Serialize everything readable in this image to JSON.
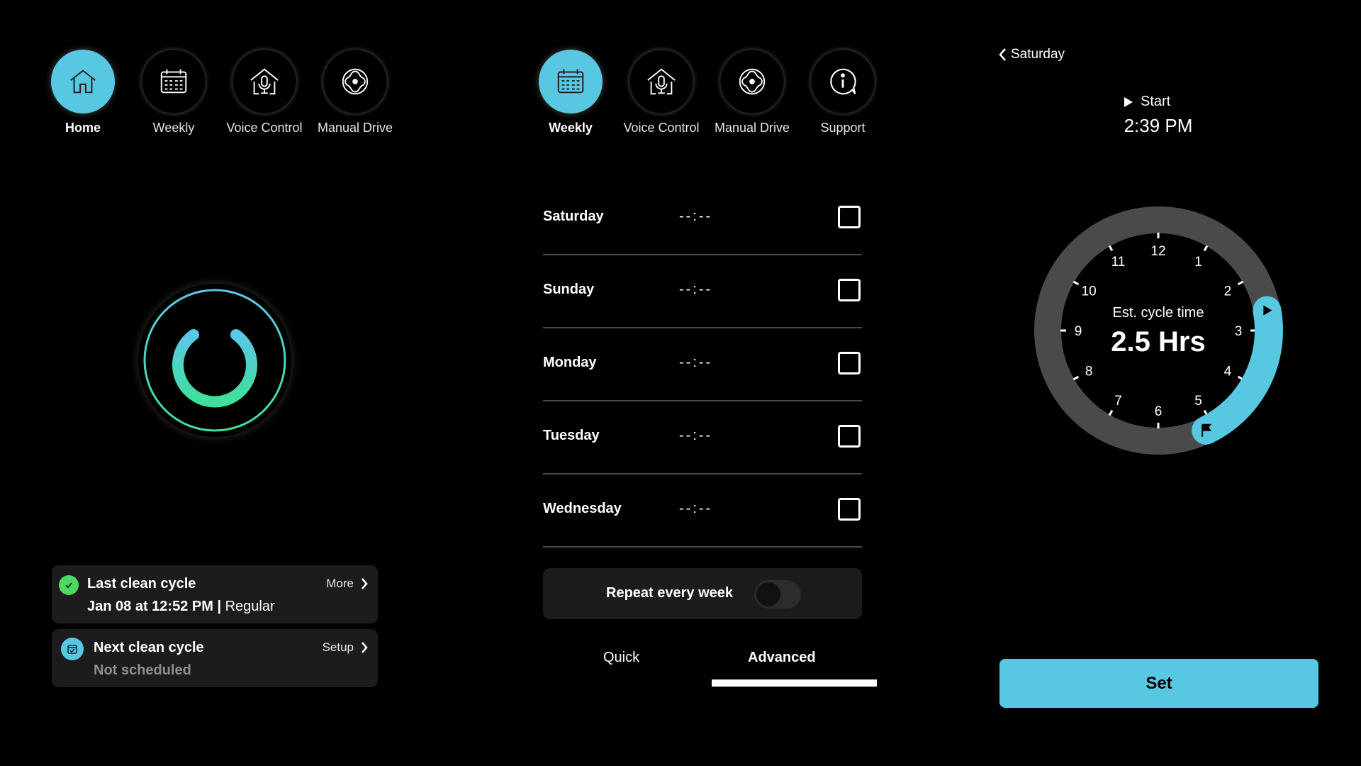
{
  "colors": {
    "accent": "#58c8e2",
    "success": "#4cd964",
    "card_bg": "#1c1c1e",
    "ring_track": "#4a4a4c",
    "power_top": "#5ac8e8",
    "power_bottom": "#3ee09a"
  },
  "home": {
    "nav": [
      {
        "label": "Home",
        "icon": "home-icon",
        "active": true
      },
      {
        "label": "Weekly",
        "icon": "calendar-icon",
        "active": false
      },
      {
        "label": "Voice Control",
        "icon": "voice-home-icon",
        "active": false
      },
      {
        "label": "Manual Drive",
        "icon": "dpad-icon",
        "active": false
      }
    ],
    "power_icon": "power-icon",
    "last_cycle": {
      "title": "Last clean cycle",
      "date": "Jan 08 at 12:52 PM",
      "separator": "|",
      "mode": "Regular",
      "action": "More",
      "icon": "check-circle-icon"
    },
    "next_cycle": {
      "title": "Next clean cycle",
      "status": "Not scheduled",
      "action": "Setup",
      "icon": "calendar-check-icon"
    }
  },
  "weekly": {
    "nav": [
      {
        "label": "Weekly",
        "icon": "calendar-icon",
        "active": true
      },
      {
        "label": "Voice Control",
        "icon": "voice-home-icon",
        "active": false
      },
      {
        "label": "Manual Drive",
        "icon": "dpad-icon",
        "active": false
      },
      {
        "label": "Support",
        "icon": "info-chat-icon",
        "active": false
      }
    ],
    "days": [
      {
        "name": "Saturday",
        "time": "--:--",
        "checked": false
      },
      {
        "name": "Sunday",
        "time": "--:--",
        "checked": false
      },
      {
        "name": "Monday",
        "time": "--:--",
        "checked": false
      },
      {
        "name": "Tuesday",
        "time": "--:--",
        "checked": false
      },
      {
        "name": "Wednesday",
        "time": "--:--",
        "checked": false
      }
    ],
    "repeat_label": "Repeat every week",
    "repeat_on": false,
    "tabs": [
      {
        "label": "Quick",
        "active": false
      },
      {
        "label": "Advanced",
        "active": true
      }
    ]
  },
  "detail": {
    "back_label": "Saturday",
    "start_label": "Start",
    "start_time": "2:39 PM",
    "est_label": "Est. cycle time",
    "est_value": "2.5 Hrs",
    "clock_numbers": [
      "12",
      "1",
      "2",
      "3",
      "4",
      "5",
      "6",
      "7",
      "8",
      "9",
      "10",
      "11"
    ],
    "arc_start_hour": 2.65,
    "arc_duration_hours": 2.5,
    "set_label": "Set"
  }
}
